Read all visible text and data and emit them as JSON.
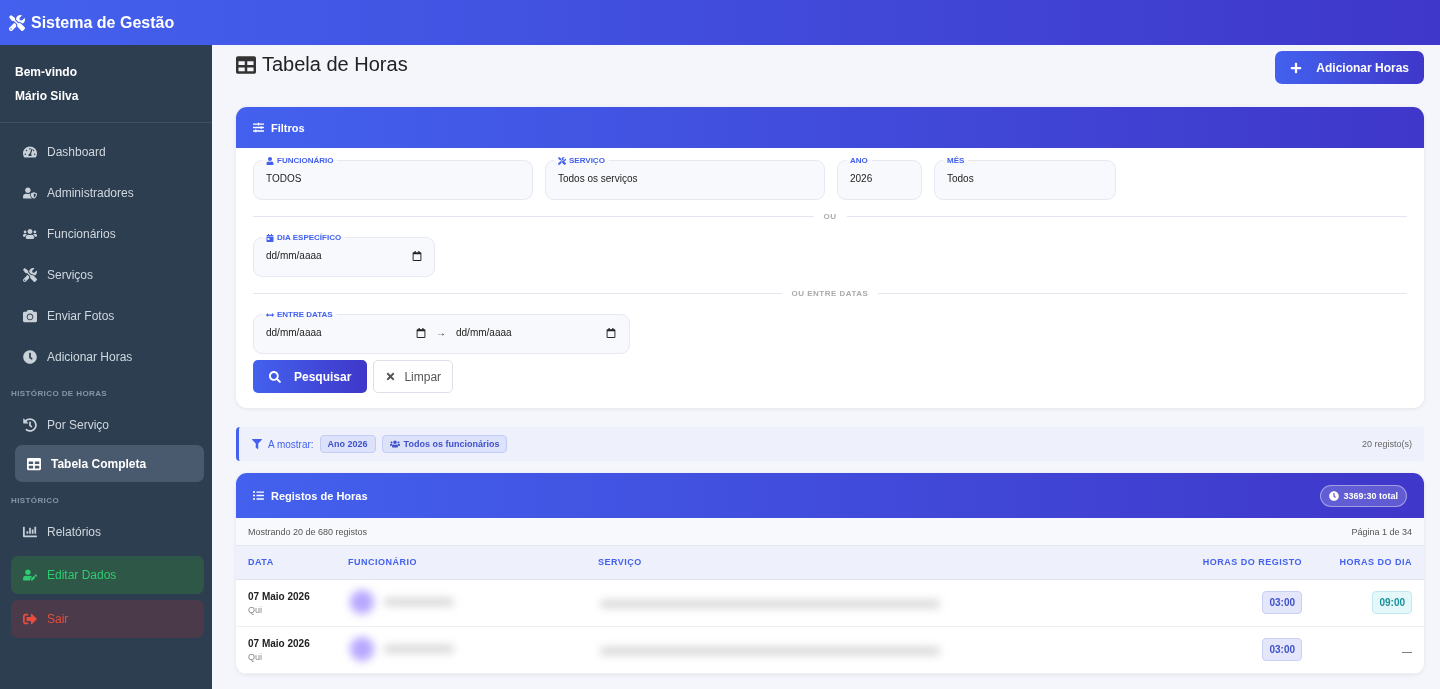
{
  "app": {
    "title": "Sistema de Gestão"
  },
  "sidebar": {
    "greeting": "Bem-vindo",
    "user": "Mário Silva",
    "items": [
      {
        "kind": "link",
        "label": "Dashboard",
        "selected": false
      },
      {
        "kind": "link",
        "label": "Administradores",
        "selected": false
      },
      {
        "kind": "link",
        "label": "Funcionários",
        "selected": false
      },
      {
        "kind": "link",
        "label": "Serviços",
        "selected": false
      },
      {
        "kind": "link",
        "label": "Enviar Fotos",
        "selected": false
      },
      {
        "kind": "link",
        "label": "Adicionar Horas",
        "selected": false
      },
      {
        "kind": "section",
        "label": "HISTÓRICO DE HORAS"
      },
      {
        "kind": "link",
        "label": "Por Serviço",
        "selected": false
      },
      {
        "kind": "link",
        "label": "Tabela Completa",
        "selected": true
      },
      {
        "kind": "section",
        "label": "HISTÓRICO"
      },
      {
        "kind": "link",
        "label": "Relatórios",
        "selected": false
      },
      {
        "kind": "success",
        "label": "Editar Dados",
        "selected": false
      },
      {
        "kind": "danger",
        "label": "Sair",
        "selected": false
      }
    ]
  },
  "page": {
    "title": "Tabela de Horas",
    "add_button": "Adicionar Horas"
  },
  "filters": {
    "title": "Filtros",
    "selects": [
      {
        "label": "FUNCIONÁRIO",
        "value": "TODOS"
      },
      {
        "label": "SERVIÇO",
        "value": "Todos os serviços"
      },
      {
        "label": "ANO",
        "value": "2026"
      },
      {
        "label": "MÊS",
        "value": "Todos"
      }
    ],
    "divider_1": "OU",
    "day": {
      "label": "DIA ESPECÍFICO",
      "placeholder": "dd/mm/aaaa"
    },
    "divider_2": "OU ENTRE DATAS",
    "range": {
      "label": "ENTRE DATAS",
      "from_placeholder": "dd/mm/aaaa",
      "arrow": "→",
      "to_placeholder": "dd/mm/aaaa"
    },
    "search_button": "Pesquisar",
    "clear_button": "Limpar"
  },
  "active_filters": {
    "label": "A mostrar:",
    "tags": [
      "Ano 2026",
      "Todos os funcionários"
    ],
    "count": "20 registo(s)"
  },
  "records": {
    "title": "Registos de Horas",
    "total": "3369:30 total",
    "showing": "Mostrando 20 de 680 registos",
    "page": "Página 1 de 34",
    "columns": [
      "DATA",
      "FUNCIONÁRIO",
      "SERVIÇO",
      "HORAS DO REGISTO",
      "HORAS DO DIA"
    ],
    "rows": [
      {
        "date": "07 Maio 2026",
        "weekday": "Qui",
        "hours": "03:00",
        "day_hours": {
          "kind": "badge",
          "text": "09:00"
        }
      },
      {
        "date": "07 Maio 2026",
        "weekday": "Qui",
        "hours": "03:00",
        "day_hours": {
          "kind": "none",
          "text": "—"
        }
      }
    ]
  }
}
